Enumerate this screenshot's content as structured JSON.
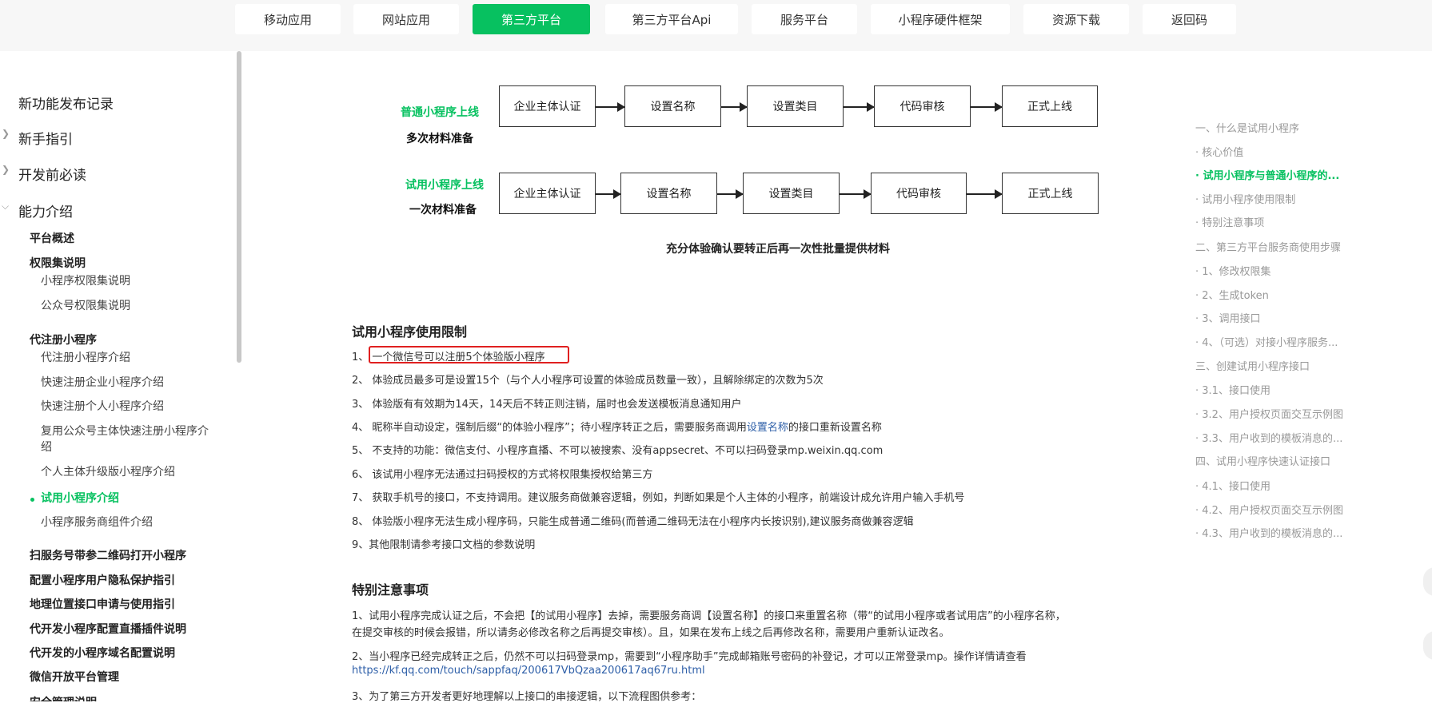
{
  "top_nav": {
    "tabs": [
      {
        "label": "移动应用",
        "active": false
      },
      {
        "label": "网站应用",
        "active": false
      },
      {
        "label": "第三方平台",
        "active": true
      },
      {
        "label": "第三方平台Api",
        "active": false
      },
      {
        "label": "服务平台",
        "active": false
      },
      {
        "label": "小程序硬件框架",
        "active": false
      },
      {
        "label": "资源下载",
        "active": false
      },
      {
        "label": "返回码",
        "active": false
      }
    ]
  },
  "sidebar": {
    "level1": [
      "新功能发布记录",
      "新手指引",
      "开发前必读",
      "能力介绍"
    ],
    "level2a": [
      "平台概述",
      "权限集说明"
    ],
    "perm_items": [
      "小程序权限集说明",
      "公众号权限集说明"
    ],
    "reg_title": "代注册小程序",
    "reg_items": [
      "代注册小程序介绍",
      "快速注册企业小程序介绍",
      "快速注册个人小程序介绍",
      "复用公众号主体快速注册小程序介绍",
      "个人主体升级版小程序介绍",
      "试用小程序介绍",
      "小程序服务商组件介绍"
    ],
    "level2b": [
      "扫服务号带参二维码打开小程序",
      "配置小程序用户隐私保护指引",
      "地理位置接口申请与使用指引",
      "代开发小程序配置直播插件说明",
      "代开发的小程序域名配置说明",
      "微信开放平台管理",
      "安全管理说明"
    ]
  },
  "flow": {
    "row1": {
      "label1": "普通小程序上线",
      "label2": "多次材料准备",
      "steps": [
        "企业主体认证",
        "设置名称",
        "设置类目",
        "代码审核",
        "正式上线"
      ]
    },
    "row2": {
      "label1": "试用小程序上线",
      "label2": "一次材料准备",
      "steps": [
        "企业主体认证",
        "设置名称",
        "设置类目",
        "代码审核",
        "正式上线"
      ]
    },
    "caption": "充分体验确认要转正后再一次性批量提供材料"
  },
  "limits": {
    "title": "试用小程序使用限制",
    "items": [
      {
        "prefix": "1、 ",
        "text": "一个微信号可以注册5个体验版小程序"
      },
      {
        "text": "2、 体验成员最多可是设置15个（与个人小程序可设置的体验成员数量一致），且解除绑定的次数为5次"
      },
      {
        "text": "3、 体验版有有效期为14天，14天后不转正则注销，届时也会发送模板消息通知用户"
      },
      {
        "before": "4、 昵称半自动设定，强制后缀“的体验小程序”；待小程序转正之后，需要服务商调用",
        "link": "设置名称",
        "after": "的接口重新设置名称"
      },
      {
        "text": "5、 不支持的功能：微信支付、小程序直播、不可以被搜索、没有appsecret、不可以扫码登录mp.weixin.qq.com"
      },
      {
        "text": "6、 该试用小程序无法通过扫码授权的方式将权限集授权给第三方"
      },
      {
        "text": "7、 获取手机号的接口，不支持调用。建议服务商做兼容逻辑，例如，判断如果是个人主体的小程序，前端设计成允许用户输入手机号"
      },
      {
        "text": "8、 体验版小程序无法生成小程序码，只能生成普通二维码(而普通二维码无法在小程序内长按识别),建议服务商做兼容逻辑"
      },
      {
        "text": "9、其他限制请参考接口文档的参数说明"
      }
    ]
  },
  "notes": {
    "title": "特别注意事项",
    "p1_line1": "1、试用小程序完成认证之后，不会把【的试用小程序】去掉，需要服务商调【设置名称】的接口来重置名称（带“的试用小程序或者试用店”的小程序名称，",
    "p1_line2": "在提交审核的时候会报错，所以请务必修改名称之后再提交审核）。且，如果在发布上线之后再修改名称，需要用户重新认证改名。",
    "p2_line1": "2、当小程序已经完成转正之后，仍然不可以扫码登录mp，需要到“小程序助手”完成邮箱账号密码的补登记，才可以正常登录mp。操作详情请查看",
    "p2_link": "https://kf.qq.com/touch/sappfaq/200617VbQzaa200617aq67ru.html",
    "p3_line1": "3、为了第三方开发者更好地理解以上接口的串接逻辑，以下流程图供参考："
  },
  "toc": [
    {
      "label": "一、什么是试用小程序",
      "active": false
    },
    {
      "label": "· 核心价值",
      "active": false
    },
    {
      "label": "· 试用小程序与普通小程序的...",
      "active": true
    },
    {
      "label": "· 试用小程序使用限制",
      "active": false
    },
    {
      "label": "· 特别注意事项",
      "active": false
    },
    {
      "label": "二、第三方平台服务商使用步骤",
      "active": false
    },
    {
      "label": "· 1、修改权限集",
      "active": false
    },
    {
      "label": "· 2、生成token",
      "active": false
    },
    {
      "label": "· 3、调用接口",
      "active": false
    },
    {
      "label": "· 4、（可选）对接小程序服务...",
      "active": false
    },
    {
      "label": "三、创建试用小程序接口",
      "active": false
    },
    {
      "label": "· 3.1、接口使用",
      "active": false
    },
    {
      "label": "· 3.2、用户授权页面交互示例图",
      "active": false
    },
    {
      "label": "· 3.3、用户收到的模板消息的...",
      "active": false
    },
    {
      "label": "四、试用小程序快速认证接口",
      "active": false
    },
    {
      "label": "· 4.1、接口使用",
      "active": false
    },
    {
      "label": "· 4.2、用户授权页面交互示例图",
      "active": false
    },
    {
      "label": "· 4.3、用户收到的模板消息的...",
      "active": false
    }
  ]
}
